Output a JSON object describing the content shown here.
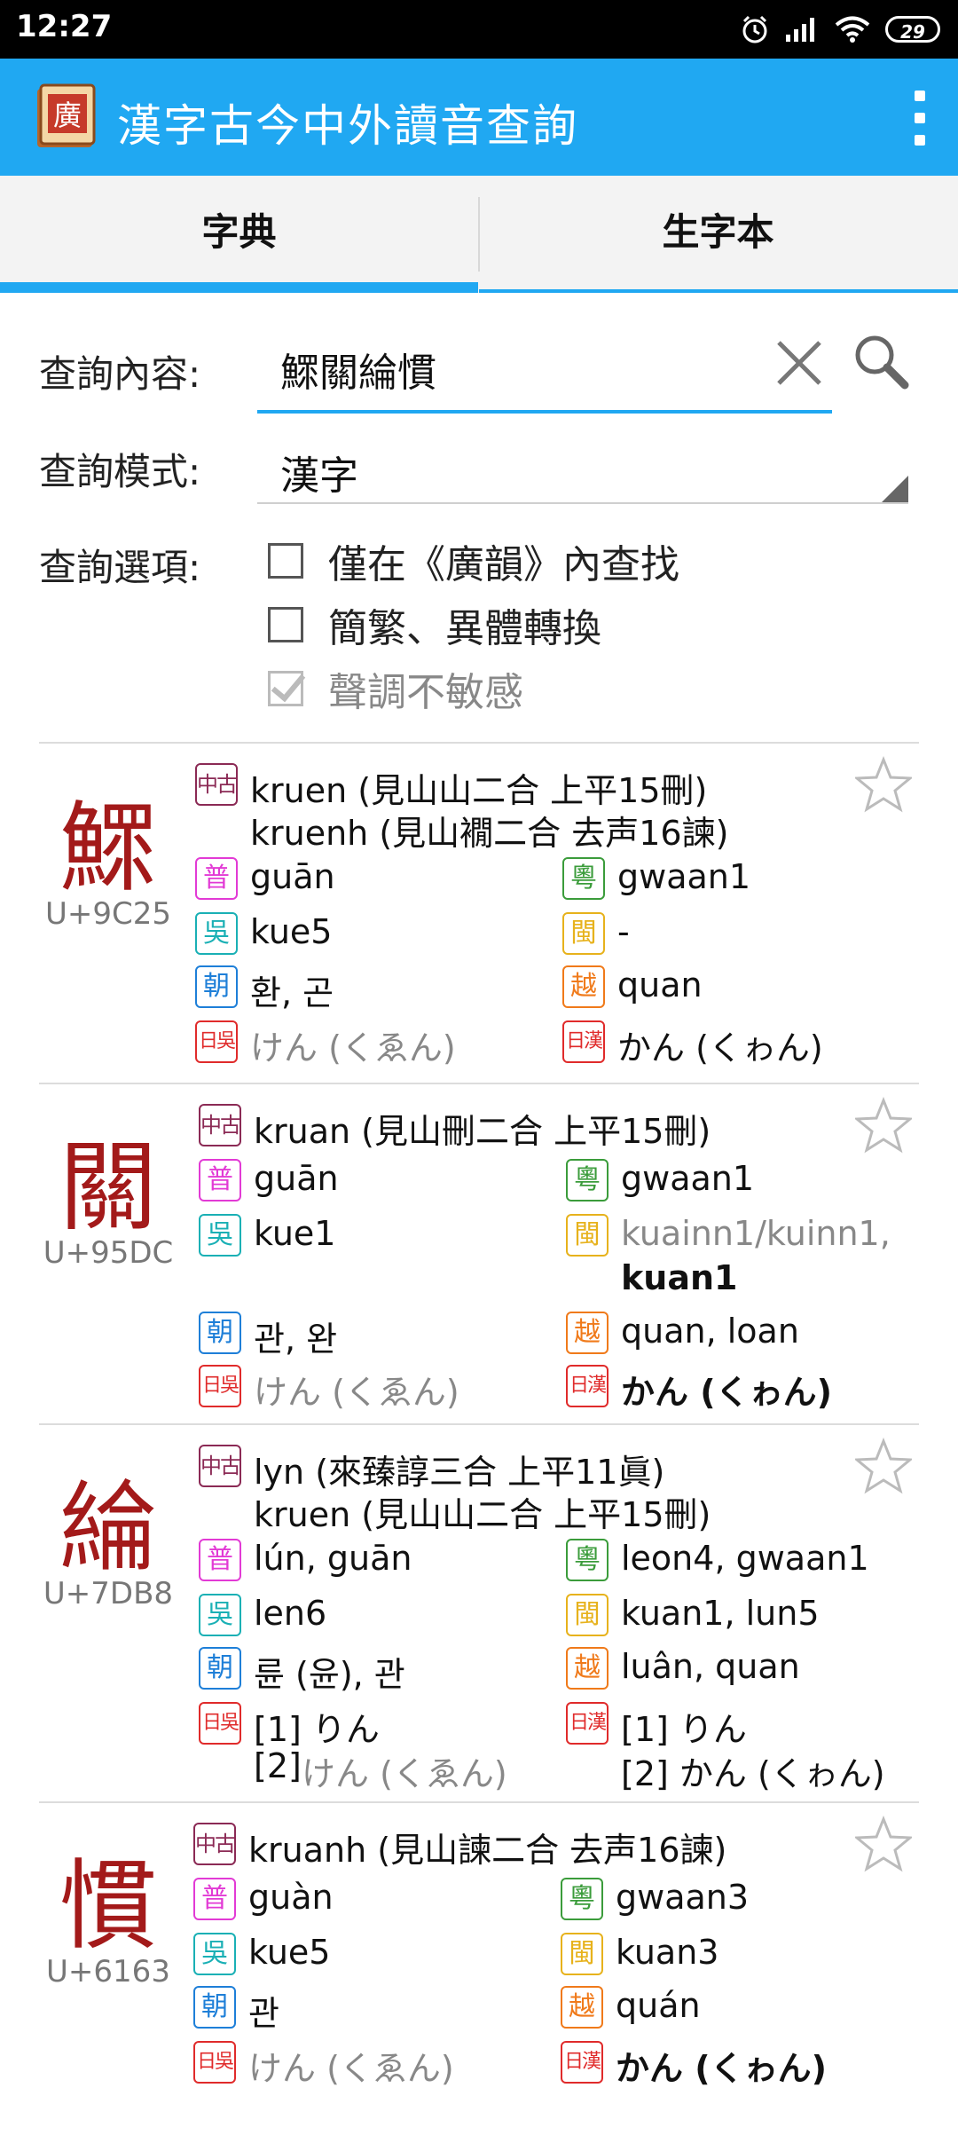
{
  "status_bar": {
    "time": "12:27",
    "battery": "29"
  },
  "app_bar": {
    "title": "漢字古今中外讀音查詢",
    "logo_char": "廣"
  },
  "tabs": [
    {
      "label": "字典"
    },
    {
      "label": "生字本"
    }
  ],
  "form": {
    "query_label": "查詢內容:",
    "query_value": "鰥關綸慣",
    "mode_label": "查詢模式:",
    "mode_value": "漢字",
    "options_label": "查詢選項:",
    "options": [
      {
        "label": "僅在《廣韻》內查找",
        "checked": false,
        "enabled": true
      },
      {
        "label": "簡繁、異體轉換",
        "checked": false,
        "enabled": true
      },
      {
        "label": "聲調不敏感",
        "checked": true,
        "enabled": false
      }
    ]
  },
  "badges": {
    "mc": "中古",
    "pu": "普",
    "yue": "粵",
    "wu": "吳",
    "min": "閩",
    "kor": "朝",
    "vi": "越",
    "jgo": "日吳",
    "jkan": "日漢"
  },
  "entries": [
    {
      "char": "鰥",
      "code": "U+9C25",
      "mc": [
        "kruen   (見山山二合 上平15刪)",
        "kruenh (見山襉二合 去声16諫)"
      ],
      "pu": "guān",
      "yue": "gwaan1",
      "wu": "kue5",
      "min": "-",
      "kor": "환, 곤",
      "vi": "quan",
      "jgo": "けん (くゑん)",
      "jkan": "かん (くゎん)"
    },
    {
      "char": "關",
      "code": "U+95DC",
      "mc": [
        "kruan (見山刪二合 上平15刪)"
      ],
      "pu": "guān",
      "yue": "gwaan1",
      "wu": "kue1",
      "min_gray": "kuainn1/kuinn1,",
      "min_bold": "kuan1",
      "kor": "관, 완",
      "vi": "quan, loan",
      "jgo": "けん (くゑん)",
      "jkan": "かん (くゎん)"
    },
    {
      "char": "綸",
      "code": "U+7DB8",
      "mc": [
        "lyn      (來臻諄三合 上平11眞)",
        "kruen (見山山二合 上平15刪)"
      ],
      "pu": "lún, guān",
      "yue": "leon4, gwaan1",
      "wu": "len6",
      "min": "kuan1, lun5",
      "kor": "륜 (윤), 관",
      "vi": "luân, quan",
      "jgo_1": "[1] りん",
      "jgo_2_num": "[2] ",
      "jgo_2": "けん (くゑん)",
      "jkan_1": "[1] りん",
      "jkan_2": "[2] かん (くゎん)"
    },
    {
      "char": "慣",
      "code": "U+6163",
      "mc": [
        "kruanh (見山諫二合 去声16諫)"
      ],
      "pu": "guàn",
      "yue": "gwaan3",
      "wu": "kue5",
      "min": "kuan3",
      "kor": "관",
      "vi": "quán",
      "jgo": "けん (くゑん)",
      "jkan": "かん (くゎん)"
    }
  ]
}
